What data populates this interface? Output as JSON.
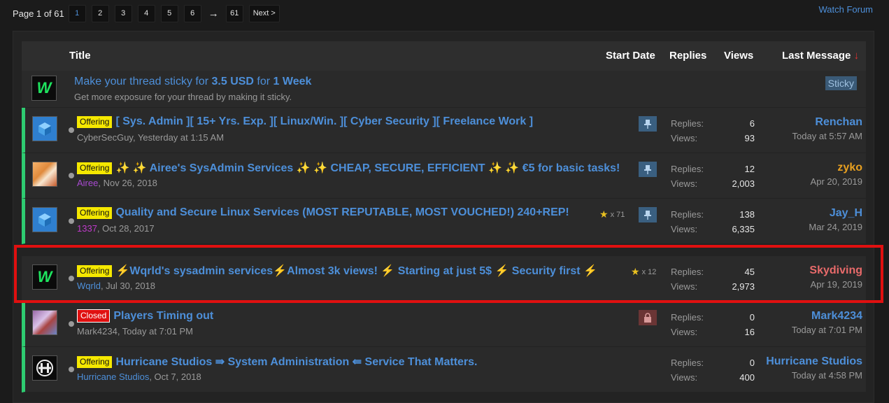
{
  "pagination": {
    "label": "Page 1 of 61",
    "pages": [
      "1",
      "2",
      "3",
      "4",
      "5",
      "6"
    ],
    "active": "1",
    "arrow": "→",
    "last": "61",
    "next": "Next >"
  },
  "watch_forum": "Watch Forum",
  "columns": {
    "title": "Title",
    "start_date": "Start Date",
    "replies": "Replies",
    "views": "Views",
    "last_message": "Last Message",
    "sort_arrow": "↓"
  },
  "promo": {
    "pre": "Make your thread sticky for ",
    "price": "3.5 USD",
    "mid": " for ",
    "duration": "1 Week",
    "subtitle": "Get more exposure for your thread by making it sticky.",
    "sticky_label": "Sticky"
  },
  "labels": {
    "replies": "Replies:",
    "views": "Views:"
  },
  "threads": [
    {
      "badge": "Offering",
      "title": "[ Sys. Admin ][ 15+ Yrs. Exp. ][ Linux/Win. ][ Cyber Security ][ Freelance Work ]",
      "author": "CyberSecGuy",
      "date": ", Yesterday at 1:15 AM",
      "replies": "6",
      "views": "93",
      "last_user": "Renchan",
      "last_date": "Today at 5:57 AM"
    },
    {
      "badge": "Offering",
      "title": "✨ ✨ Airee's SysAdmin Services ✨ ✨ CHEAP, SECURE, EFFICIENT ✨ ✨ €5 for basic tasks!",
      "author": "Airee",
      "date": ", Nov 26, 2018",
      "replies": "12",
      "views": "2,003",
      "last_user": "zyko",
      "last_date": "Apr 20, 2019"
    },
    {
      "badge": "Offering",
      "title": "Quality and Secure Linux Services (MOST REPUTABLE, MOST VOUCHED!) 240+REP!",
      "author": "1337",
      "date": ", Oct 28, 2017",
      "rep": "x 71",
      "replies": "138",
      "views": "6,335",
      "last_user": "Jay_H",
      "last_date": "Mar 24, 2019"
    },
    {
      "badge": "Offering",
      "title": "⚡Wqrld's sysadmin services⚡Almost 3k views! ⚡ Starting at just 5$ ⚡ Security first ⚡",
      "author": "Wqrld",
      "date": ", Jul 30, 2018",
      "rep": "x 12",
      "replies": "45",
      "views": "2,973",
      "last_user": "Skydiving",
      "last_date": "Apr 19, 2019"
    },
    {
      "badge": "Closed",
      "title": "Players Timing out",
      "author": "Mark4234",
      "date": ", Today at 7:01 PM",
      "replies": "0",
      "views": "16",
      "last_user": "Mark4234",
      "last_date": "Today at 7:01 PM"
    },
    {
      "badge": "Offering",
      "title": "Hurricane Studios ⇛ System Administration ⇚ Service That Matters.",
      "author": "Hurricane Studios",
      "date": ", Oct 7, 2018",
      "replies": "0",
      "views": "400",
      "last_user": "Hurricane Studios",
      "last_date": "Today at 4:58 PM"
    }
  ]
}
